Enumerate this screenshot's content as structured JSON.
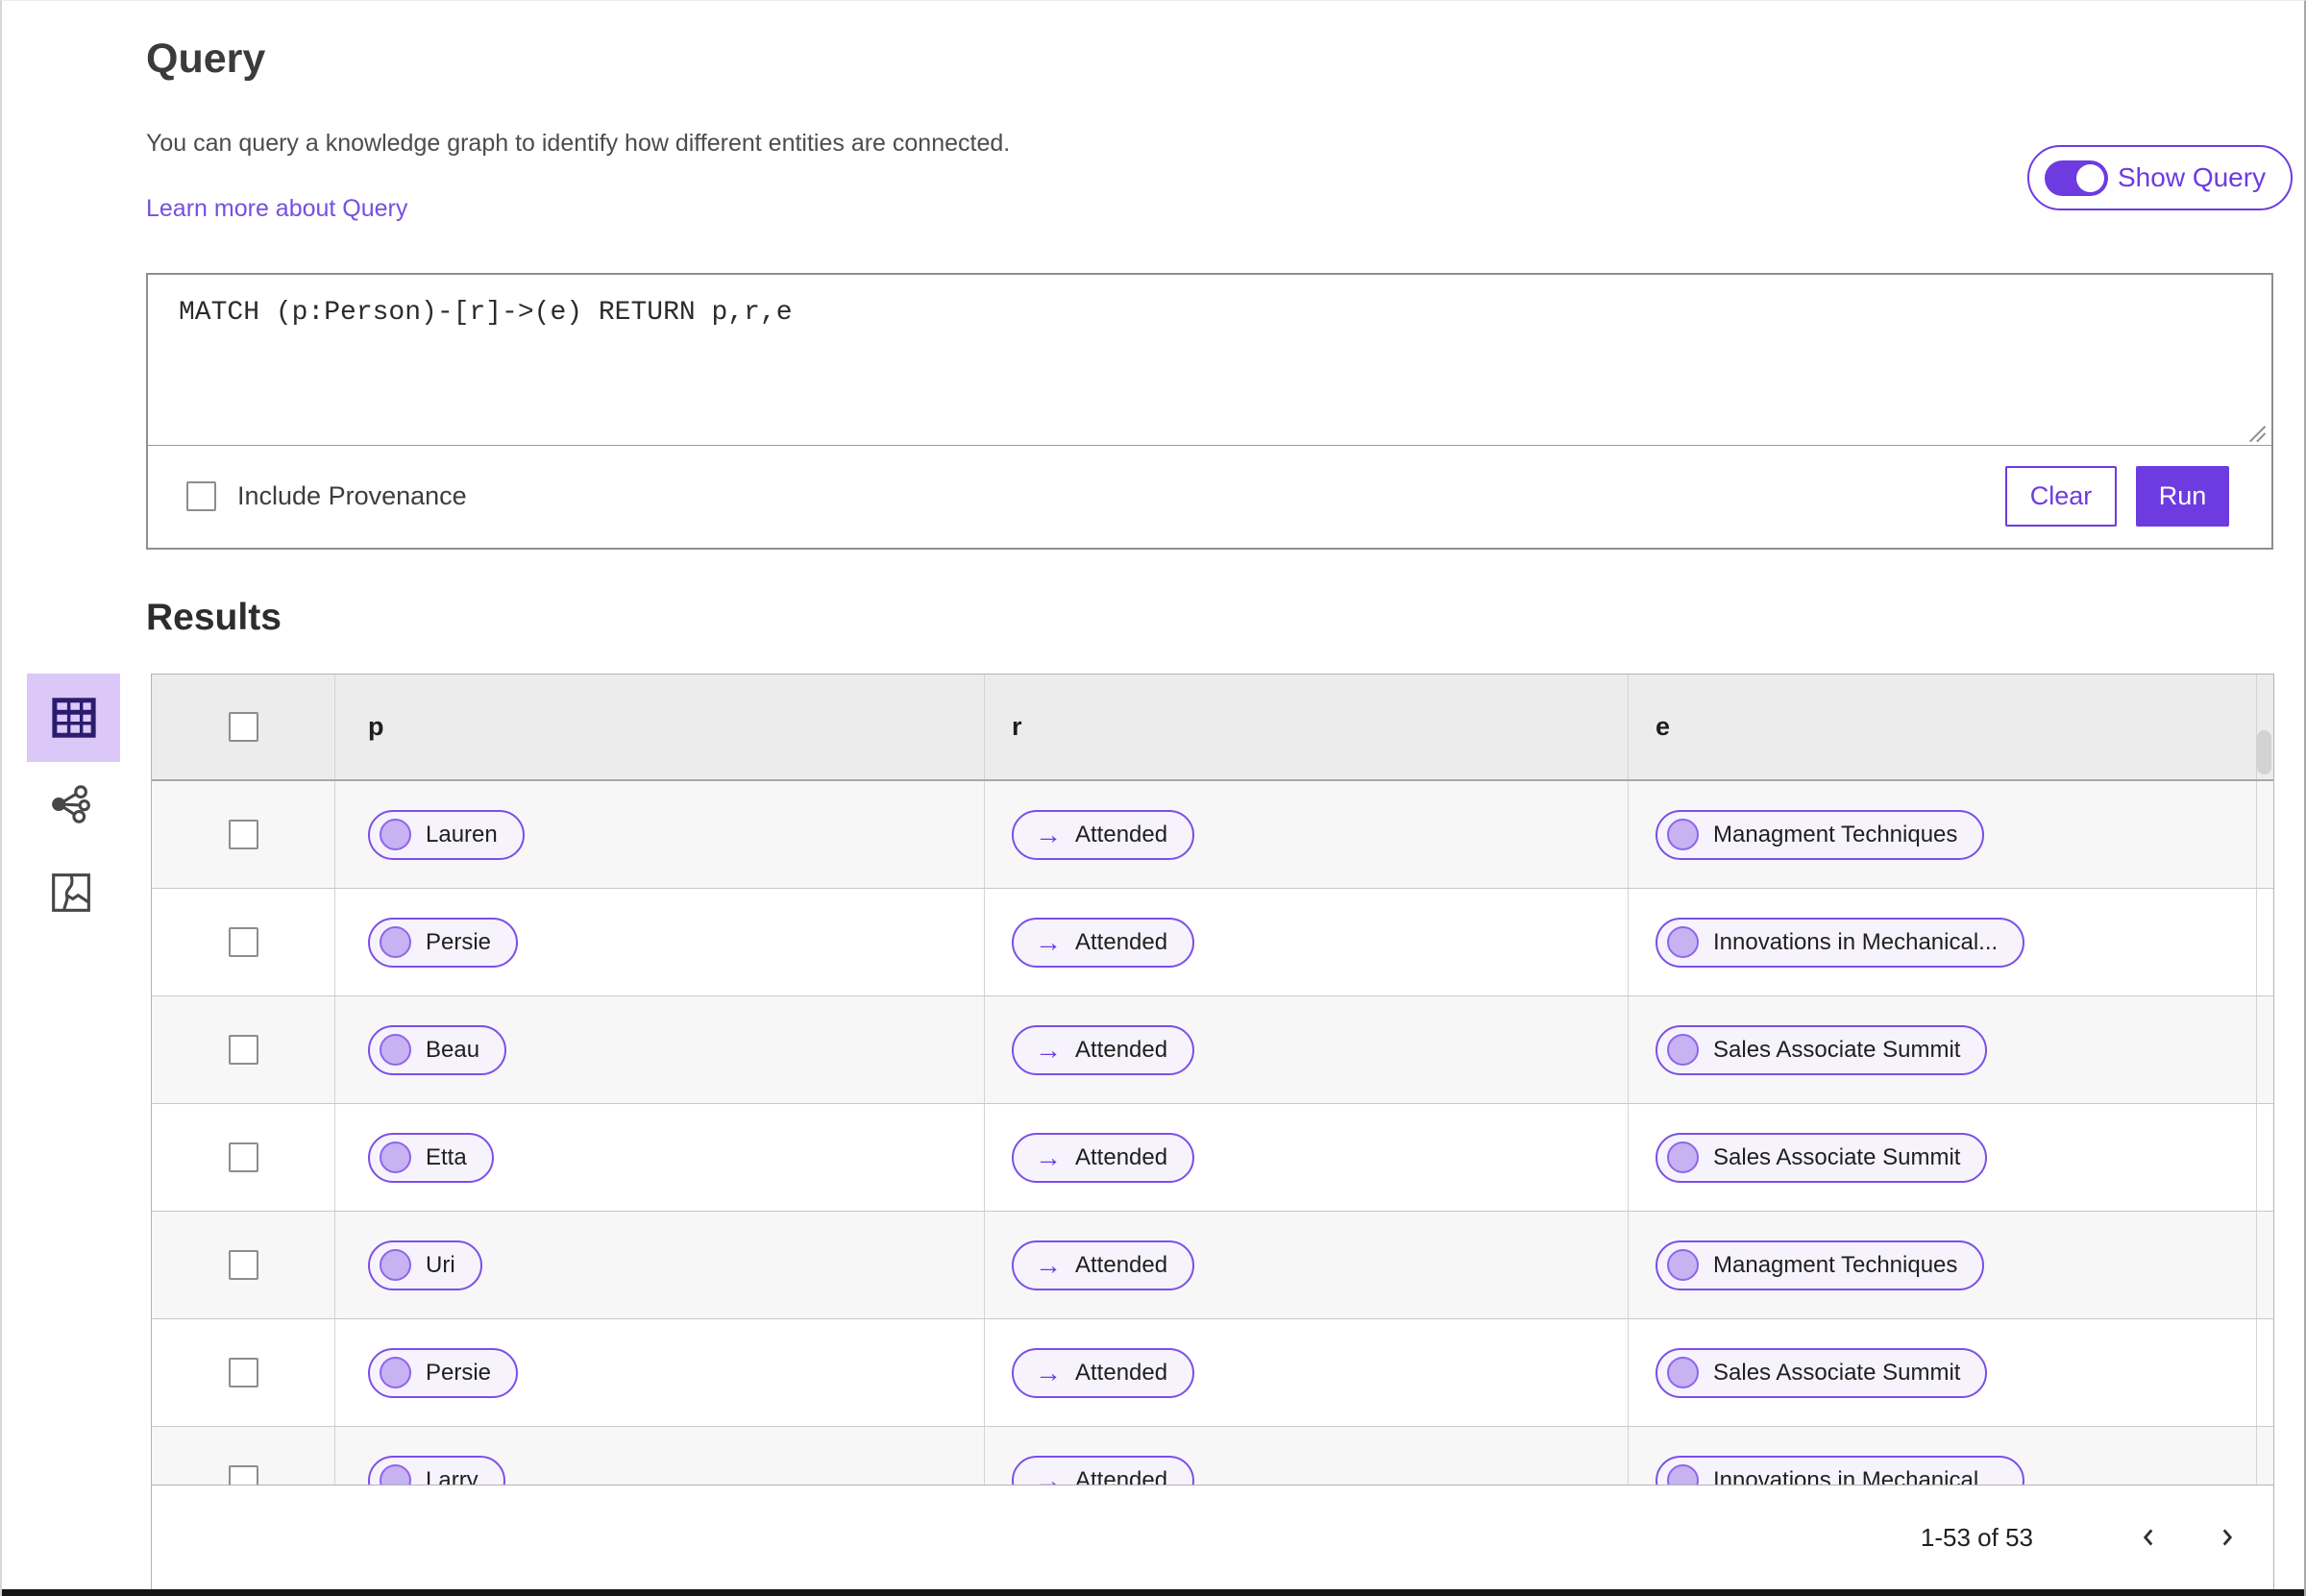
{
  "page": {
    "title": "Query",
    "description": "You can query a knowledge graph to identify how different entities are connected.",
    "learn_more": "Learn more about Query",
    "show_query_label": "Show Query",
    "show_query_on": true
  },
  "query_editor": {
    "text": "MATCH (p:Person)-[r]->(e) RETURN p,r,e",
    "include_provenance_label": "Include Provenance",
    "include_provenance_checked": false,
    "clear_label": "Clear",
    "run_label": "Run"
  },
  "results": {
    "title": "Results",
    "view_switcher": [
      {
        "name": "table-view",
        "selected": true
      },
      {
        "name": "graph-view",
        "selected": false
      },
      {
        "name": "map-view",
        "selected": false
      }
    ],
    "columns": [
      "p",
      "r",
      "e"
    ],
    "relation_arrow": "→",
    "rows": [
      {
        "p": "Lauren",
        "r": "Attended",
        "e": "Managment Techniques"
      },
      {
        "p": "Persie",
        "r": "Attended",
        "e": "Innovations in Mechanical..."
      },
      {
        "p": "Beau",
        "r": "Attended",
        "e": "Sales Associate Summit"
      },
      {
        "p": "Etta",
        "r": "Attended",
        "e": "Sales Associate Summit"
      },
      {
        "p": "Uri",
        "r": "Attended",
        "e": "Managment Techniques"
      },
      {
        "p": "Persie",
        "r": "Attended",
        "e": "Sales Associate Summit"
      },
      {
        "p": "Larry",
        "r": "Attended",
        "e": "Innovations in Mechanical..."
      }
    ],
    "pagination": {
      "range_label": "1-53 of 53"
    }
  },
  "colors": {
    "accent_purple": "#6d3be0",
    "pill_border": "#7b4fe8",
    "pill_background": "#f6f3fd",
    "pill_dot_fill": "#c7b2f2",
    "selected_view_background": "#dbc8f9",
    "table_header_background": "#ececec",
    "row_stripe_background": "#f7f7f7",
    "link_purple": "#7450e0"
  }
}
